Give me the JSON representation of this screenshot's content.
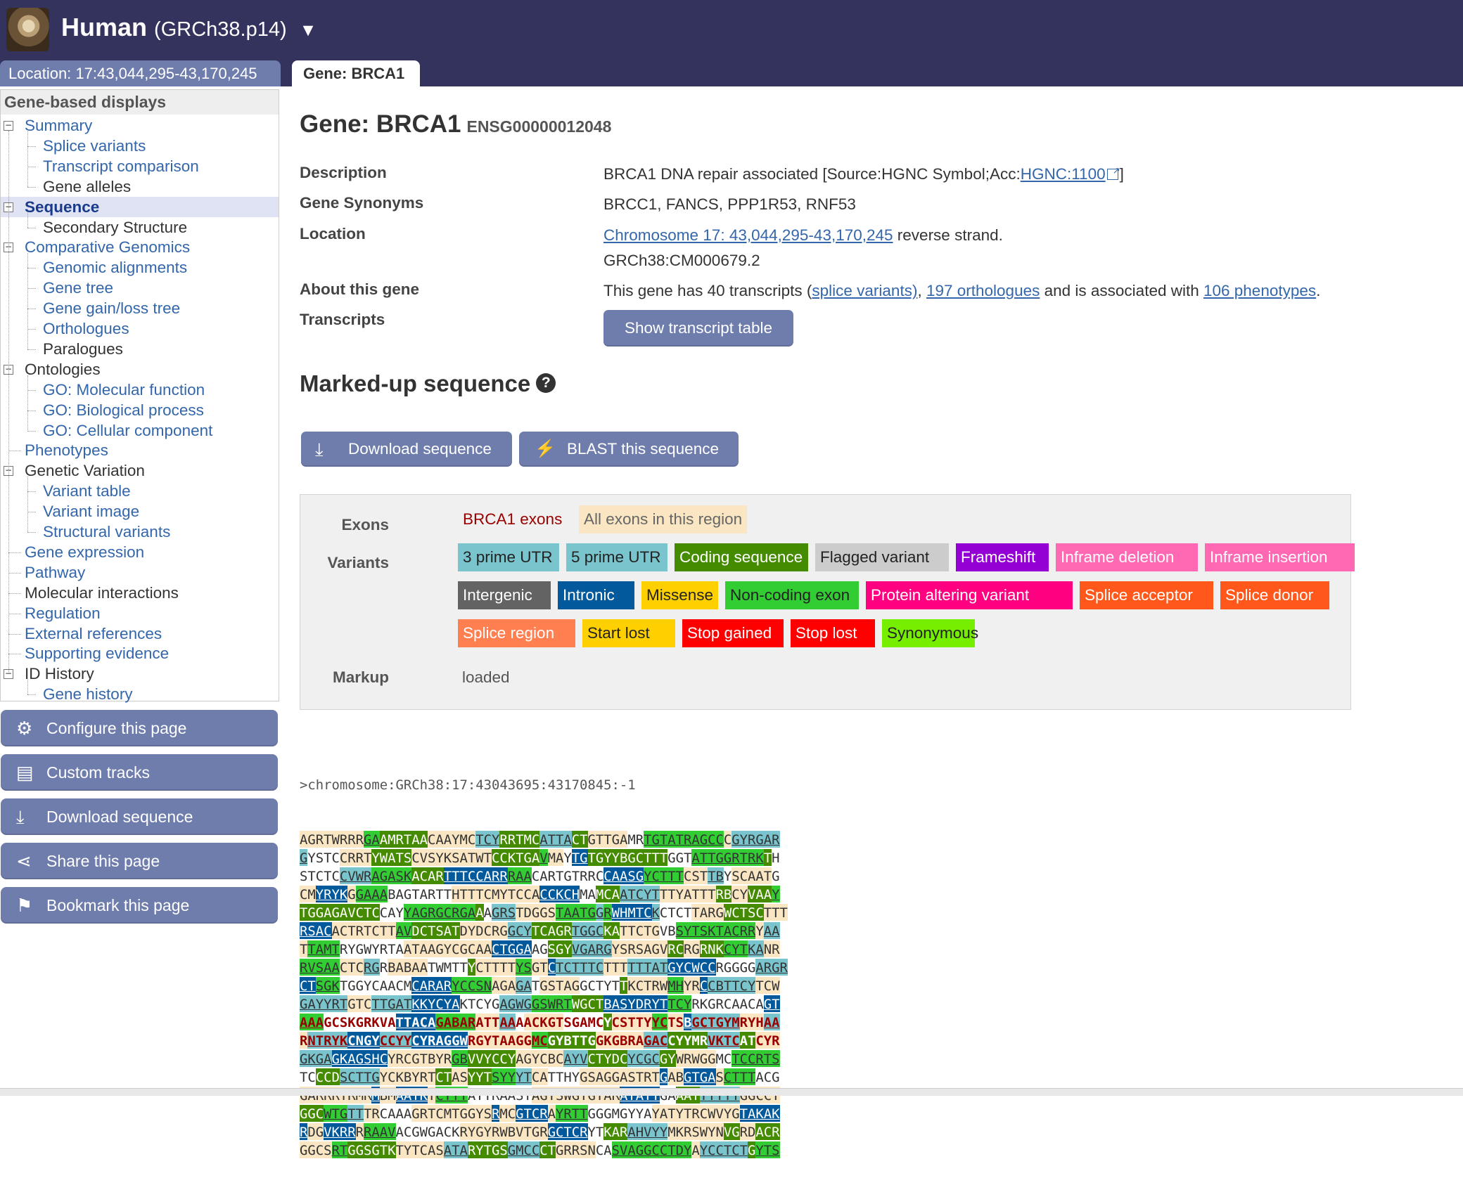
{
  "masthead": {
    "species": "Human",
    "assembly": "(GRCh38.p14)",
    "caret": "▼"
  },
  "tabs": {
    "location": "Location: 17:43,044,295-43,170,245",
    "gene": "Gene: BRCA1"
  },
  "nav": {
    "header": "Gene-based displays",
    "items": [
      {
        "label": "Summary",
        "level": 0,
        "toggle": "⊟",
        "link": true
      },
      {
        "label": "Splice variants",
        "level": 1,
        "link": true
      },
      {
        "label": "Transcript comparison",
        "level": 1,
        "link": true
      },
      {
        "label": "Gene alleles",
        "level": 1,
        "link": false
      },
      {
        "label": "Sequence",
        "level": 0,
        "toggle": "⊟",
        "link": true,
        "active": true
      },
      {
        "label": "Secondary Structure",
        "level": 1,
        "link": false
      },
      {
        "label": "Comparative Genomics",
        "level": 0,
        "toggle": "⊟",
        "link": true
      },
      {
        "label": "Genomic alignments",
        "level": 1,
        "link": true
      },
      {
        "label": "Gene tree",
        "level": 1,
        "link": true
      },
      {
        "label": "Gene gain/loss tree",
        "level": 1,
        "link": true
      },
      {
        "label": "Orthologues",
        "level": 1,
        "link": true
      },
      {
        "label": "Paralogues",
        "level": 1,
        "link": false
      },
      {
        "label": "Ontologies",
        "level": 0,
        "toggle": "⊟",
        "link": false
      },
      {
        "label": "GO: Molecular function",
        "level": 1,
        "link": true
      },
      {
        "label": "GO: Biological process",
        "level": 1,
        "link": true
      },
      {
        "label": "GO: Cellular component",
        "level": 1,
        "link": true
      },
      {
        "label": "Phenotypes",
        "level": 0,
        "link": true
      },
      {
        "label": "Genetic Variation",
        "level": 0,
        "toggle": "⊟",
        "link": false
      },
      {
        "label": "Variant table",
        "level": 1,
        "link": true
      },
      {
        "label": "Variant image",
        "level": 1,
        "link": true
      },
      {
        "label": "Structural variants",
        "level": 1,
        "link": true
      },
      {
        "label": "Gene expression",
        "level": 0,
        "link": true
      },
      {
        "label": "Pathway",
        "level": 0,
        "link": true
      },
      {
        "label": "Molecular interactions",
        "level": 0,
        "link": false
      },
      {
        "label": "Regulation",
        "level": 0,
        "link": true
      },
      {
        "label": "External references",
        "level": 0,
        "link": true
      },
      {
        "label": "Supporting evidence",
        "level": 0,
        "link": true
      },
      {
        "label": "ID History",
        "level": 0,
        "toggle": "⊟",
        "link": false
      },
      {
        "label": "Gene history",
        "level": 1,
        "link": true
      }
    ]
  },
  "side_buttons": [
    {
      "label": "Configure this page",
      "icon": "gear-icon",
      "glyph": "⚙"
    },
    {
      "label": "Custom tracks",
      "icon": "custom-tracks-icon",
      "glyph": "▤"
    },
    {
      "label": "Download sequence",
      "icon": "download-icon",
      "glyph": "⤓"
    },
    {
      "label": "Share this page",
      "icon": "share-icon",
      "glyph": "⋖"
    },
    {
      "label": "Bookmark this page",
      "icon": "bookmark-icon",
      "glyph": "⚑"
    }
  ],
  "gene": {
    "title": "Gene: BRCA1",
    "id": "ENSG00000012048"
  },
  "summary": {
    "description_label": "Description",
    "description_text": "BRCA1 DNA repair associated [Source:HGNC Symbol;Acc:",
    "description_link": "HGNC:1100",
    "description_end": "]",
    "synonyms_label": "Gene Synonyms",
    "synonyms": "BRCC1, FANCS, PPP1R53, RNF53",
    "location_label": "Location",
    "location_link": "Chromosome 17: 43,044,295-43,170,245",
    "location_strand": " reverse strand.",
    "location_assembly": "GRCh38:CM000679.2",
    "about_label": "About this gene",
    "about_prefix": "This gene has 40 transcripts (",
    "about_splice": "splice variants)",
    "about_sep": ", ",
    "about_orthologues": "197 orthologues",
    "about_mid": " and is associated with ",
    "about_phenotypes": "106 phenotypes",
    "about_end": ".",
    "transcripts_label": "Transcripts",
    "transcript_button": "Show transcript table"
  },
  "markup": {
    "heading": "Marked-up sequence",
    "help": "?",
    "download_button": "Download sequence",
    "blast_button": "BLAST this sequence"
  },
  "legend": {
    "exons_label": "Exons",
    "variants_label": "Variants",
    "markup_label": "Markup",
    "markup_value": "loaded",
    "exons": [
      {
        "label": "BRCA1 exons",
        "bg": "#f0f0f0",
        "fg": "#990000"
      },
      {
        "label": "All exons in this region",
        "bg": "#fae6c3",
        "fg": "#666666"
      }
    ],
    "variants": [
      {
        "label": "3 prime UTR",
        "bg": "#7ac5cd",
        "fg": "#222222"
      },
      {
        "label": "5 prime UTR",
        "bg": "#7ac5cd",
        "fg": "#222222"
      },
      {
        "label": "Coding sequence",
        "bg": "#458b00",
        "fg": "#ffffff"
      },
      {
        "label": "Flagged variant",
        "bg": "#cccccc",
        "fg": "#222222"
      },
      {
        "label": "Frameshift",
        "bg": "#9400d3",
        "fg": "#ffffff"
      },
      {
        "label": "Inframe deletion",
        "bg": "#ff69b4",
        "fg": "#ffffff"
      },
      {
        "label": "Inframe insertion",
        "bg": "#ff69b4",
        "fg": "#ffffff"
      },
      {
        "label": "Intergenic",
        "bg": "#636363",
        "fg": "#ffffff"
      },
      {
        "label": "Intronic",
        "bg": "#02599c",
        "fg": "#ffffff"
      },
      {
        "label": "Missense",
        "bg": "#ffd000",
        "fg": "#222222"
      },
      {
        "label": "Non-coding exon",
        "bg": "#32cd32",
        "fg": "#222222"
      },
      {
        "label": "Protein altering variant",
        "bg": "#ff0080",
        "fg": "#ffffff"
      },
      {
        "label": "Splice acceptor",
        "bg": "#ff581a",
        "fg": "#ffffff"
      },
      {
        "label": "Splice donor",
        "bg": "#ff581a",
        "fg": "#ffffff"
      },
      {
        "label": "Splice region",
        "bg": "#ff7f50",
        "fg": "#ffffff"
      },
      {
        "label": "Start lost",
        "bg": "#ffd000",
        "fg": "#222222"
      },
      {
        "label": "Stop gained",
        "bg": "#ff0000",
        "fg": "#ffffff"
      },
      {
        "label": "Stop lost",
        "bg": "#ff0000",
        "fg": "#ffffff"
      },
      {
        "label": "Synonymous",
        "bg": "#76ee00",
        "fg": "#222222"
      }
    ]
  },
  "sequence": {
    "header": ">chromosome:GRCh38:17:43043695:43170845:-1",
    "lines": [
      "AGRTWRRRGAAMRTAACAAYMCTCYRRTMCATTACTGTTGAMRTGTATRAGCCCGYRGAR",
      "GYSTCCRRTYWATSCVSYKSATWTCCKTGAVMAYTGTGYYBGCTTTGGTATTGGRTRKTH",
      "STCTCCVWRAGASKACARTTTCCARRRAACARTGTRRCCAASGYCTTTCSTTBYSCAATG",
      "CMYRYKGGAAABAGTARTTHTTTCMYTCCACCKCHMAMCAATCYTTTYATTTRBCYVAAY",
      "TGGAGAVCTCCAYYAGRGCRGAAAGRSTDGGSTAATGGRWHMTCKCTCTTARGWCTSCTTT",
      "RSACACTRTCTTAVDCTSATDYDCRGGCYTCAGRTGGCKATTCTGVBSYTSKTACRRYAA",
      "TTAMTRYGWYRTAATAAGYCGCAACTGGAAGSGYVGARGYSRSAGVRCRGRNKCYTKANR",
      "RVSAACTCRGRBABAATWMTTYCTTTTYSGTCTCTTTCTTTTTTATGYCWCCRGGGGARGR",
      "CTSGKTGGYCAACMCARARYCCSNAGAGATGSTAGGCTYTTKCTRWMHYRCCBTTCYTCW",
      "GAYYRTGTCTTGATKKYCYAKTCYGAGWGGSWRTWGCTBASYDRYTTCYRKGRCAACAGT",
      "AAAGCSKGRKVATTACAGABARATTAAAACKGTSGAMCYCSTTYYCTSBGCTGYMRYHAA",
      "RNTRYKCNGYCCYYCYRAGGWRGYTAAGGMCGYBTTGGKGBRAGACCYYMRVKTCATCYR",
      "GKGAGKAGSHCYRCGTBYRGBVVYCCYAGYCBCAYVCTYDCYCGCGYWRWGGMCTCCRTS",
      "TCCCDSCTTGYCKBYRTCTASYYTSYYYTCATTHYGSAGGASTRTGABGTGASCTTTACG",
      "GARRRTRMRMBMAATKYCYTTAYTRAASYAGYSWGYGTARATAYTGAAAYTTTTTGGCCT",
      "GGCWTGTTTRCAAAGRTCMTGGYSRMCGTCRAYRTTGGGMGYYAYATYTRCWVYGTAKAK",
      "RDGVKRRRRAAVACGWGACKRYGYRWBVTGRGCTCRYTKARAHVYYMKRSWYNVGRDACR",
      "GGCSRTGGSGTKTYTCASATARYTGSGMCCCTGRRSNCASVAGGCCTDYAYCCTCTGYTS"
    ],
    "palette": [
      "#fae6c3",
      "#7ac5cd",
      "#32cd32",
      "#02599c",
      "#fae6c3",
      "#458b00",
      "#ffffff"
    ]
  }
}
